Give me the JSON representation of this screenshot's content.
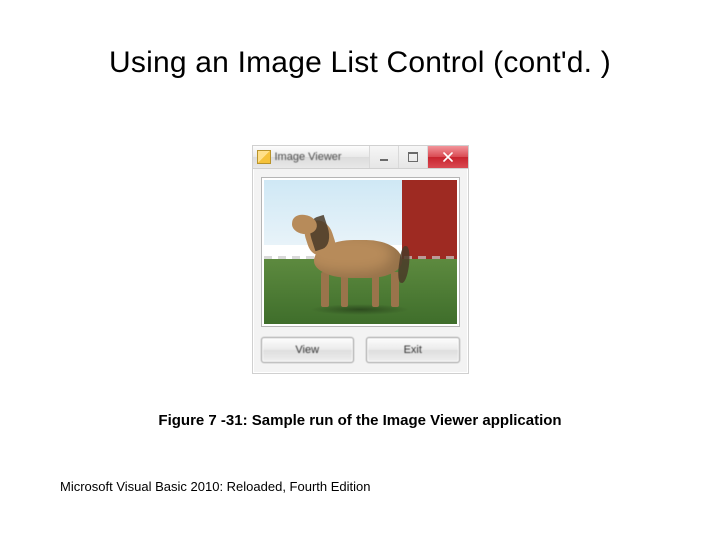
{
  "title": "Using an Image List Control (cont'd. )",
  "dialog": {
    "app_title": "Image Viewer",
    "buttons": {
      "view": "View",
      "exit": "Exit"
    }
  },
  "caption": "Figure 7 -31: Sample run of the Image Viewer application",
  "footer": "Microsoft Visual Basic 2010: Reloaded, Fourth Edition"
}
